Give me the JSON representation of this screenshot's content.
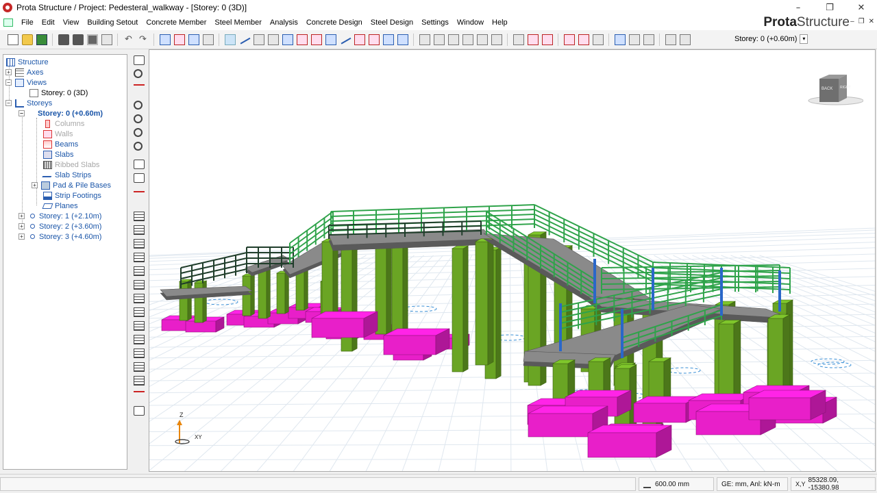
{
  "window": {
    "title": "Prota Structure / Project: Pedesteral_walkway - [Storey: 0 (3D)]",
    "minimize": "–",
    "maximize": "❐",
    "close": "✕"
  },
  "menu": {
    "items": [
      "File",
      "Edit",
      "View",
      "Building Setout",
      "Concrete Member",
      "Steel Member",
      "Analysis",
      "Concrete Design",
      "Steel Design",
      "Settings",
      "Window",
      "Help"
    ],
    "brand_bold": "Prota",
    "brand_regular": "Structure",
    "mdi": [
      "–",
      "❐",
      "✕"
    ]
  },
  "toolbar": {
    "storey_label": "Storey: 0 (+0.60m)",
    "dropdown_glyph": "▾",
    "undo_glyph": "↶",
    "redo_glyph": "↷"
  },
  "tree": {
    "root": "Structure",
    "axes": "Axes",
    "views": "Views",
    "view_storey0": "Storey: 0 (3D)",
    "storeys": "Storeys",
    "storey0": "Storey: 0 (+0.60m)",
    "columns": "Columns",
    "walls": "Walls",
    "beams": "Beams",
    "slabs": "Slabs",
    "ribbed_slabs": "Ribbed Slabs",
    "slab_strips": "Slab Strips",
    "pad_pile": "Pad & Pile Bases",
    "strip_footings": "Strip Footings",
    "planes": "Planes",
    "storey1": "Storey: 1 (+2.10m)",
    "storey2": "Storey: 2 (+3.60m)",
    "storey3": "Storey: 3 (+4.60m)",
    "expand": "+",
    "collapse": "−"
  },
  "viewport": {
    "axis_z": "Z",
    "axis_xy": "XY",
    "cube_left": "BACK",
    "cube_right": "RIGHT",
    "colors": {
      "column": "#6aa524",
      "footing": "#e81fc9",
      "slab": "#8a8a8a",
      "railing_green": "#2fa34a",
      "railing_blue": "#2a67c9",
      "grid": "#dfe7ef"
    }
  },
  "status": {
    "snap_value": "600.00 mm",
    "units": "GE: mm,  Anl: kN-m",
    "coords_prefix": "X,Y",
    "coords": "85328.09, -15380.98"
  }
}
